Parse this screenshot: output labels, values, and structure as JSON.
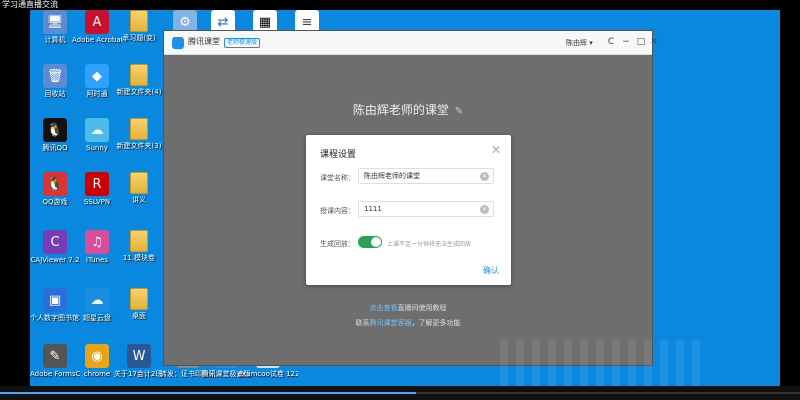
{
  "window_title": "学习通直播交流",
  "desktop_icons": [
    {
      "label": "计算机",
      "glyph": "🖥",
      "color": "#5b8bd1"
    },
    {
      "label": "Adobe Acrobat…",
      "glyph": "A",
      "color": "#c8102e"
    },
    {
      "label": "承习题(变)",
      "glyph": "",
      "color": "#e4b23c"
    },
    {
      "label": "回收站",
      "glyph": "🗑",
      "color": "#5b8bd1"
    },
    {
      "label": "阿时通",
      "glyph": "◆",
      "color": "#2ea0ff"
    },
    {
      "label": "新建文件夹(4)",
      "glyph": "",
      "color": "#e4b23c"
    },
    {
      "label": "腾讯QQ",
      "glyph": "🐧",
      "color": "#111"
    },
    {
      "label": "Sunny",
      "glyph": "☁",
      "color": "#4dbbe8"
    },
    {
      "label": "新建文件夹(3)",
      "glyph": "",
      "color": "#e4b23c"
    },
    {
      "label": "QQ游戏",
      "glyph": "🐧",
      "color": "#d33"
    },
    {
      "label": "SSLVPN",
      "glyph": "R",
      "color": "#c00"
    },
    {
      "label": "讲义",
      "glyph": "",
      "color": "#e4b23c"
    },
    {
      "label": "CAJViewer 7.2",
      "glyph": "C",
      "color": "#7a3cb6"
    },
    {
      "label": "iTunes",
      "glyph": "♫",
      "color": "#d94c9a"
    },
    {
      "label": "11.模块卷",
      "glyph": "",
      "color": "#e4b23c"
    },
    {
      "label": "个人数字图书馆2.1",
      "glyph": "▣",
      "color": "#2b6fd6"
    },
    {
      "label": "超星云盘",
      "glyph": "☁",
      "color": "#1a8de0"
    },
    {
      "label": "桌面",
      "glyph": "",
      "color": "#e4b23c"
    },
    {
      "label": "Adobe FormsCen…",
      "glyph": "✎",
      "color": "#555"
    },
    {
      "label": "chrome",
      "glyph": "◉",
      "color": "#e8a317"
    },
    {
      "label": "关于17会计2班学案说明…",
      "glyph": "W",
      "color": "#2b5797"
    }
  ],
  "taskbar_items": [
    {
      "label": "转发：证书印象采证"
    },
    {
      "label": "腾讯课堂极速版"
    },
    {
      "label": "examcoo试卷 122782…"
    }
  ],
  "app": {
    "name": "腾讯课堂",
    "badge": "老师极速版",
    "user": "陈由辉 ▾",
    "refresh_icon": "C",
    "minimize_icon": "−",
    "maximize_icon": "□",
    "close_icon": "✕",
    "room_title": "陈由辉老师的课堂",
    "room_edit_icon": "✎"
  },
  "dialog": {
    "title": "课程设置",
    "close": "✕",
    "course_name_label": "课堂名称：",
    "course_name_value": "陈由辉老师的课堂",
    "content_label": "授课内容：",
    "content_value": "1111",
    "replay_label": "生成回放：",
    "replay_enabled": true,
    "replay_hint": "上课不足一分钟将无法生成回放",
    "confirm": "确认"
  },
  "footer": {
    "line1_link": "点击查看",
    "line1_rest": "直播间使用教程",
    "line2_prefix": "联系",
    "line2_link": "腾讯课堂客服",
    "line2_rest": "，了解更多功能"
  },
  "playback": {
    "progress_fraction": 0.52
  }
}
